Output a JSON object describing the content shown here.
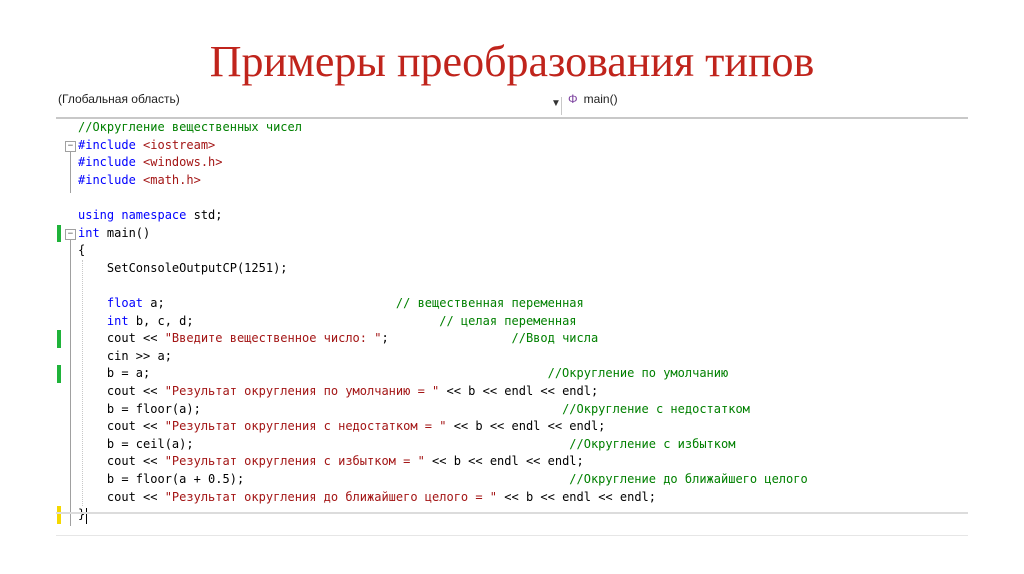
{
  "slide": {
    "title": "Примеры преобразования типов"
  },
  "editor": {
    "scope_dropdown": "(Глобальная область)",
    "function_dropdown": "main()",
    "lines": [
      {
        "parts": [
          {
            "t": "//Округление вещественных чисел",
            "c": "cm"
          }
        ]
      },
      {
        "parts": [
          {
            "t": "#include ",
            "c": "kw"
          },
          {
            "t": "<iostream>",
            "c": "str"
          }
        ]
      },
      {
        "parts": [
          {
            "t": "#include ",
            "c": "kw"
          },
          {
            "t": "<windows.h>",
            "c": "str"
          }
        ]
      },
      {
        "parts": [
          {
            "t": "#include ",
            "c": "kw"
          },
          {
            "t": "<math.h>",
            "c": "str"
          }
        ]
      },
      {
        "parts": []
      },
      {
        "parts": [
          {
            "t": "using ",
            "c": "kw"
          },
          {
            "t": "namespace ",
            "c": "kw"
          },
          {
            "t": "std;",
            "c": ""
          }
        ]
      },
      {
        "parts": [
          {
            "t": "int ",
            "c": "kw"
          },
          {
            "t": "main()",
            "c": ""
          }
        ]
      },
      {
        "parts": [
          {
            "t": "{",
            "c": ""
          }
        ]
      },
      {
        "parts": [
          {
            "t": "    SetConsoleOutputCP(1251);",
            "c": ""
          }
        ]
      },
      {
        "parts": []
      },
      {
        "parts": [
          {
            "t": "    ",
            "c": ""
          },
          {
            "t": "float ",
            "c": "kw"
          },
          {
            "t": "a;                                ",
            "c": ""
          },
          {
            "t": "// вещественная переменная",
            "c": "cm"
          }
        ]
      },
      {
        "parts": [
          {
            "t": "    ",
            "c": ""
          },
          {
            "t": "int ",
            "c": "kw"
          },
          {
            "t": "b, c, d;                                  ",
            "c": ""
          },
          {
            "t": "// целая переменная",
            "c": "cm"
          }
        ]
      },
      {
        "parts": [
          {
            "t": "    cout << ",
            "c": ""
          },
          {
            "t": "\"Введите вещественное число: \"",
            "c": "str"
          },
          {
            "t": ";                 ",
            "c": ""
          },
          {
            "t": "//Ввод числа",
            "c": "cm"
          }
        ]
      },
      {
        "parts": [
          {
            "t": "    cin >> a;",
            "c": ""
          }
        ]
      },
      {
        "parts": [
          {
            "t": "    b = a;                                                       ",
            "c": ""
          },
          {
            "t": "//Округление по умолчанию",
            "c": "cm"
          }
        ]
      },
      {
        "parts": [
          {
            "t": "    cout << ",
            "c": ""
          },
          {
            "t": "\"Результат округления по умолчанию = \"",
            "c": "str"
          },
          {
            "t": " << b << endl << endl;",
            "c": ""
          }
        ]
      },
      {
        "parts": [
          {
            "t": "    b = floor(a);                                                  ",
            "c": ""
          },
          {
            "t": "//Округление с недостатком",
            "c": "cm"
          }
        ]
      },
      {
        "parts": [
          {
            "t": "    cout << ",
            "c": ""
          },
          {
            "t": "\"Результат округления с недостатком = \"",
            "c": "str"
          },
          {
            "t": " << b << endl << endl;",
            "c": ""
          }
        ]
      },
      {
        "parts": [
          {
            "t": "    b = ceil(a);                                                    ",
            "c": ""
          },
          {
            "t": "//Округление с избытком",
            "c": "cm"
          }
        ]
      },
      {
        "parts": [
          {
            "t": "    cout << ",
            "c": ""
          },
          {
            "t": "\"Результат округления с избытком = \"",
            "c": "str"
          },
          {
            "t": " << b << endl << endl;",
            "c": ""
          }
        ]
      },
      {
        "parts": [
          {
            "t": "    b = floor(a + 0.5);                                             ",
            "c": ""
          },
          {
            "t": "//Округление до ближайшего целого",
            "c": "cm"
          }
        ]
      },
      {
        "parts": [
          {
            "t": "    cout << ",
            "c": ""
          },
          {
            "t": "\"Результат округления до ближайшего целого = \"",
            "c": "str"
          },
          {
            "t": " << b << endl << endl;",
            "c": ""
          }
        ]
      },
      {
        "parts": [
          {
            "t": "}",
            "c": ""
          }
        ]
      }
    ]
  },
  "colors": {
    "title": "#c0241c",
    "keyword": "#0000ff",
    "string": "#a31515",
    "comment": "#008000",
    "change_saved": "#1fb33a",
    "change_unsaved": "#f5d800"
  }
}
